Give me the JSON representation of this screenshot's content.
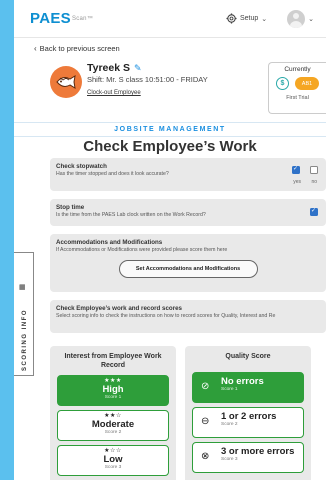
{
  "header": {
    "logo_main": "PAES",
    "logo_sub": "Scan™",
    "setup_label": "Setup",
    "setup_chevron": "⌄",
    "avatar_chevron": "⌄"
  },
  "nav": {
    "back_label": "Back to previous screen"
  },
  "employee": {
    "name": "Tyreek S",
    "shift": "Shift: Mr. S class 10:51:00 - FRIDAY",
    "checkout_link": "Clock-out Employee"
  },
  "currently": {
    "label": "Currently",
    "badge": "AB1",
    "sub": "First Trial"
  },
  "section": {
    "label": "JOBSITE MANAGEMENT"
  },
  "page": {
    "title": "Check Employee’s Work"
  },
  "scoring_tab": {
    "label": "SCORING INFO"
  },
  "cards": {
    "stopwatch": {
      "title": "Check stopwatch",
      "subtitle": "Has the timer stopped and does it look accurate?",
      "yes_label": "yes",
      "no_label": "no",
      "yes_checked": true,
      "no_checked": false
    },
    "stoptime": {
      "title": "Stop time",
      "subtitle": "Is the time from the PAES Lab clock written on the Work Record?",
      "checked": true
    },
    "accommodations": {
      "title": "Accommodations and Modifications",
      "subtitle": "If Accommodations or Modifications were provided please score them here",
      "button_label": "Set Accommodations and Modifications"
    },
    "record_scores": {
      "title": "Check Employee’s work and record scores",
      "subtitle": "Select scoring info to check the instructions on how to record scores for Quality, Interest and Re"
    }
  },
  "interest_panel": {
    "title": "Interest from Employee Work Record",
    "options": [
      {
        "stars": "★★★",
        "label": "High",
        "score": "Score 1",
        "selected": true
      },
      {
        "stars": "★★☆",
        "label": "Moderate",
        "score": "Score 2",
        "selected": false
      },
      {
        "stars": "★☆☆",
        "label": "Low",
        "score": "Score 3",
        "selected": false
      }
    ]
  },
  "quality_panel": {
    "title": "Quality Score",
    "options": [
      {
        "icon": "check-circle-icon",
        "glyph": "⊘",
        "label": "No errors",
        "score": "Score 1",
        "selected": true
      },
      {
        "icon": "minus-circle-icon",
        "glyph": "⊖",
        "label": "1 or 2 errors",
        "score": "Score 2",
        "selected": false
      },
      {
        "icon": "x-circle-icon",
        "glyph": "⊗",
        "label": "3 or more errors",
        "score": "Score 3",
        "selected": false
      }
    ]
  },
  "colors": {
    "background": "#5bc0ee",
    "brand_blue": "#1a8fe0",
    "accent_green": "#2e9e3a",
    "avatar_orange": "#ee7a3a",
    "badge_orange": "#f5a623"
  }
}
